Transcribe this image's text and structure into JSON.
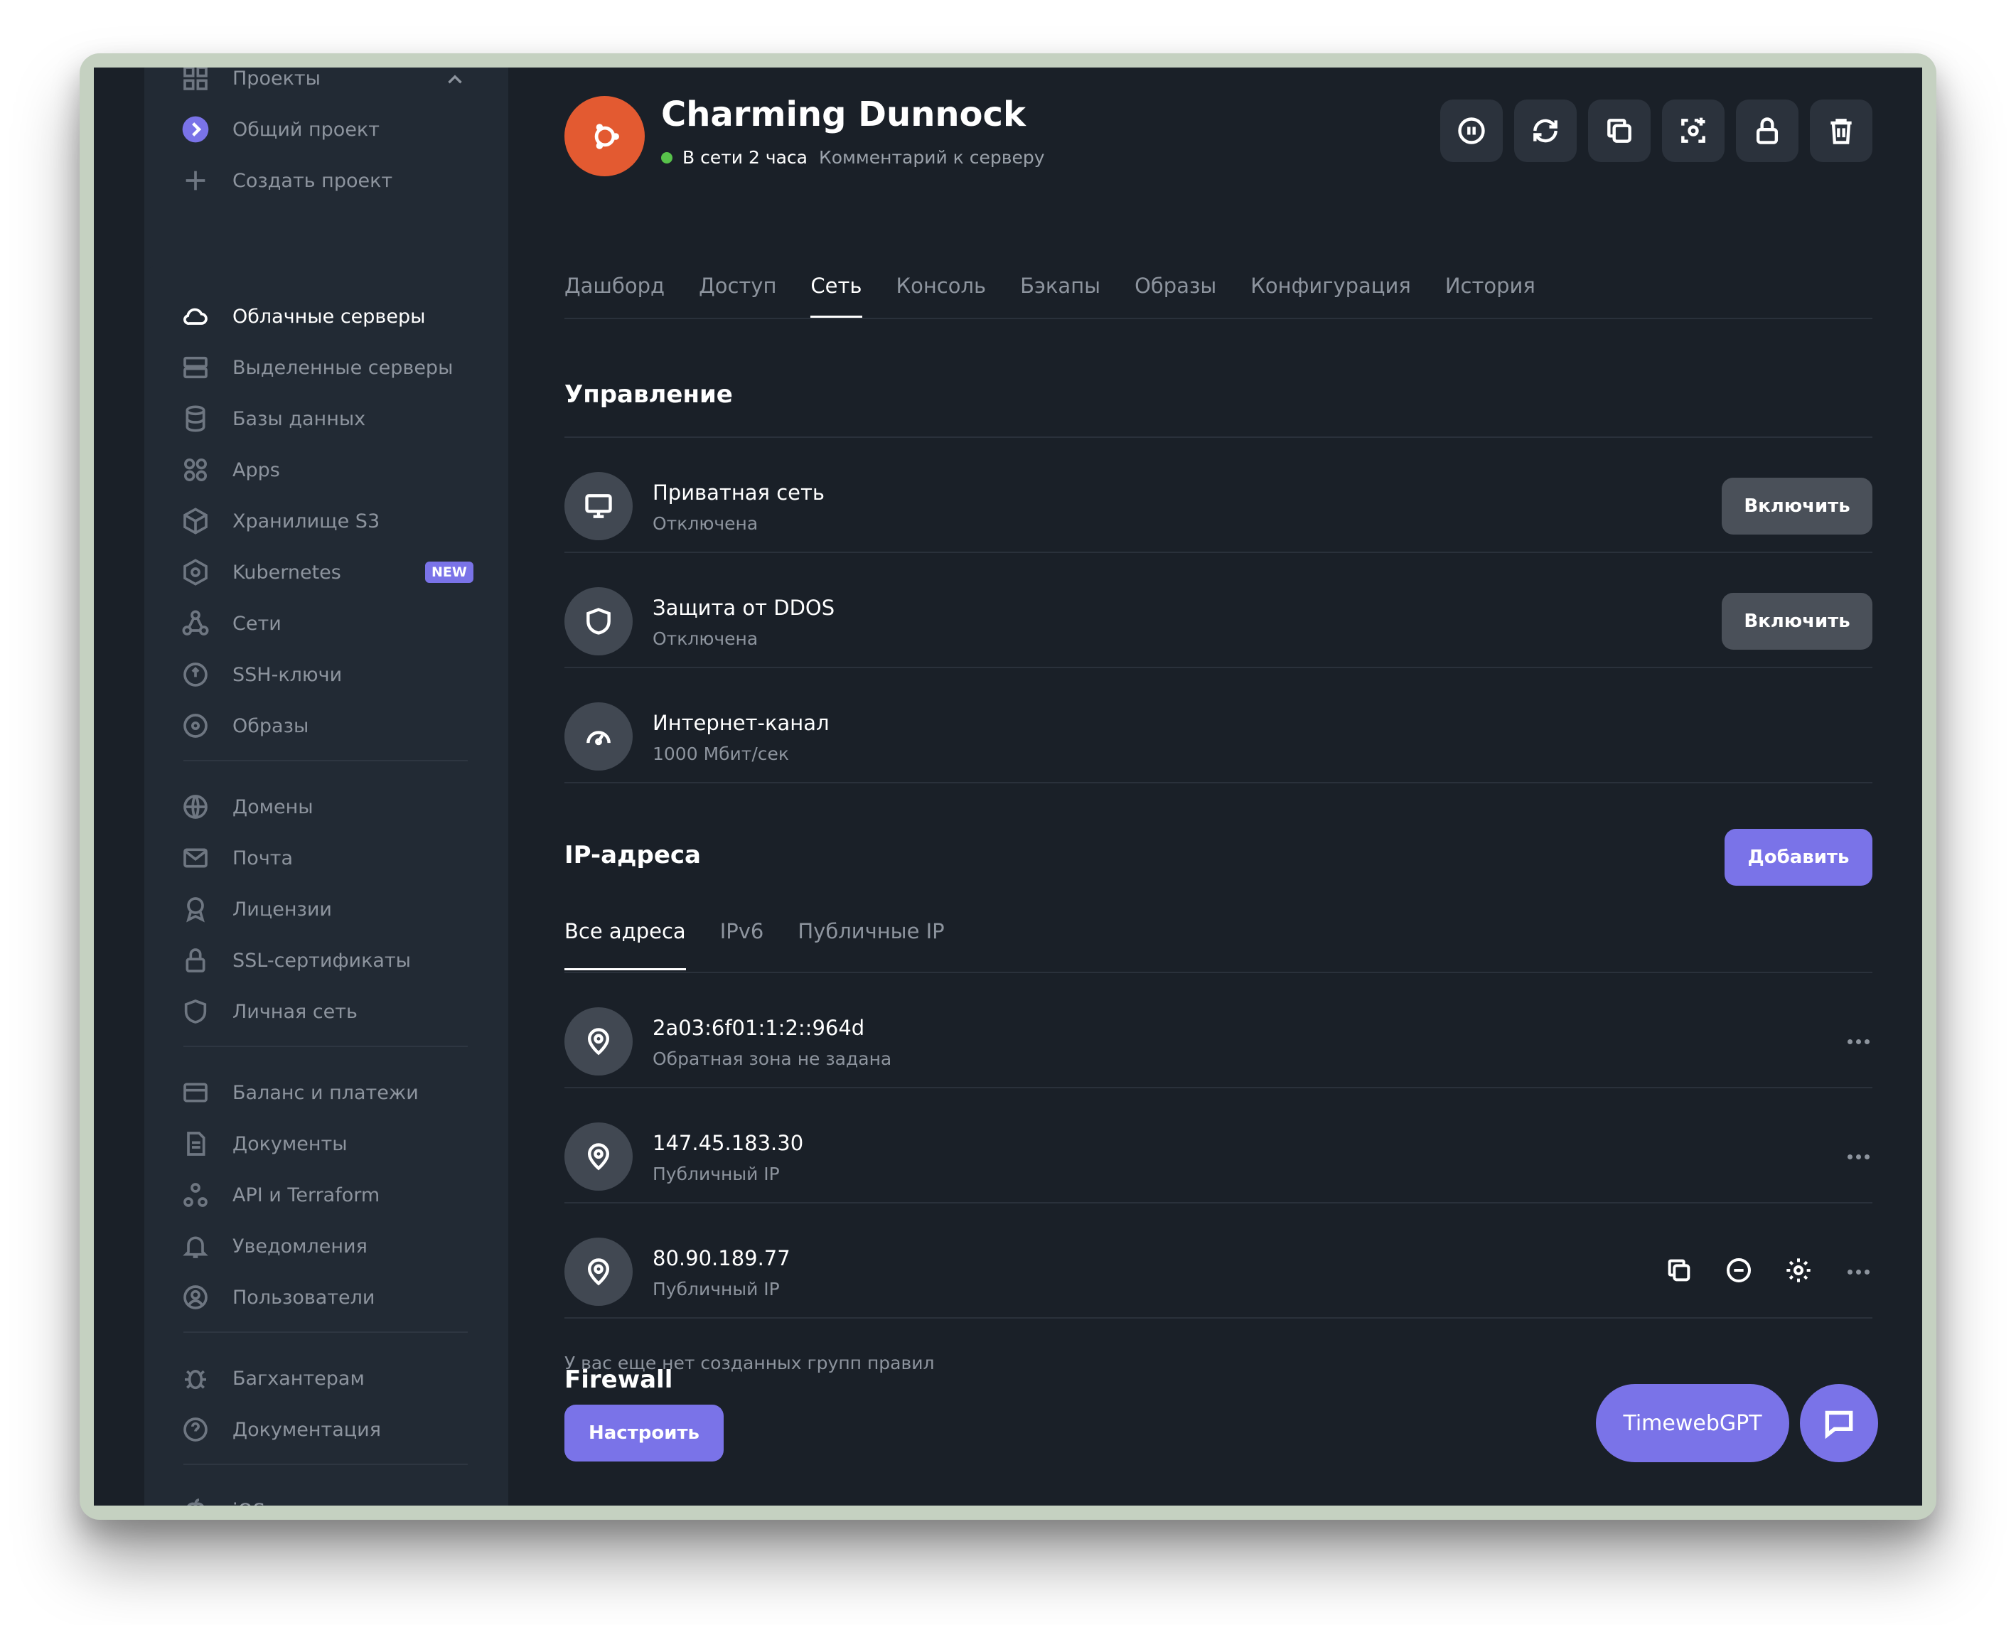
{
  "projects": {
    "header": "Проекты",
    "items": [
      "Общий проект",
      "Создать проект"
    ]
  },
  "sidebar": {
    "items": [
      {
        "label": "Облачные серверы",
        "icon": "cloud-icon"
      },
      {
        "label": "Выделенные серверы",
        "icon": "server-icon"
      },
      {
        "label": "Базы данных",
        "icon": "database-icon"
      },
      {
        "label": "Apps",
        "icon": "apps-icon"
      },
      {
        "label": "Хранилище S3",
        "icon": "cube-icon"
      },
      {
        "label": "Kubernetes",
        "icon": "kubernetes-icon",
        "badge": "NEW"
      },
      {
        "label": "Сети",
        "icon": "network-icon"
      },
      {
        "label": "SSH-ключи",
        "icon": "ssh-key-icon"
      },
      {
        "label": "Образы",
        "icon": "disc-icon"
      },
      {
        "label": "Домены",
        "icon": "globe-icon"
      },
      {
        "label": "Почта",
        "icon": "mail-icon"
      },
      {
        "label": "Лицензии",
        "icon": "license-icon"
      },
      {
        "label": "SSL-сертификаты",
        "icon": "lock-icon"
      },
      {
        "label": "Личная сеть",
        "icon": "shield-icon"
      },
      {
        "label": "Баланс и платежи",
        "icon": "card-icon"
      },
      {
        "label": "Документы",
        "icon": "document-icon"
      },
      {
        "label": "API и Terraform",
        "icon": "api-icon"
      },
      {
        "label": "Уведомления",
        "icon": "bell-icon"
      },
      {
        "label": "Пользователи",
        "icon": "user-icon"
      },
      {
        "label": "Багхантерам",
        "icon": "bug-icon"
      },
      {
        "label": "Документация",
        "icon": "help-icon"
      },
      {
        "label": "iOS приложение",
        "icon": "apple-icon"
      }
    ]
  },
  "server": {
    "name": "Charming Dunnock",
    "status": "В сети 2 часа",
    "comment": "Комментарий к серверу"
  },
  "tabs": [
    "Дашборд",
    "Доступ",
    "Сеть",
    "Консоль",
    "Бэкапы",
    "Образы",
    "Конфигурация",
    "История"
  ],
  "management": {
    "title": "Управление",
    "rows": [
      {
        "title": "Приватная сеть",
        "sub": "Отключена",
        "button": "Включить"
      },
      {
        "title": "Защита от DDOS",
        "sub": "Отключена",
        "button": "Включить"
      },
      {
        "title": "Интернет-канал",
        "sub": "1000 Мбит/сек"
      }
    ]
  },
  "ip": {
    "title": "IP-адреса",
    "add_label": "Добавить",
    "tabs": [
      "Все адреса",
      "IPv6",
      "Публичные IP"
    ],
    "rows": [
      {
        "address": "2a03:6f01:1:2::964d",
        "sub": "Обратная зона не задана"
      },
      {
        "address": "147.45.183.30",
        "sub": "Публичный IP"
      },
      {
        "address": "80.90.189.77",
        "sub": "Публичный IP"
      }
    ]
  },
  "firewall": {
    "title": "Firewall",
    "desc": "У вас еще нет созданных групп правил",
    "button": "Настроить"
  },
  "fab": {
    "gpt_label": "TimewebGPT"
  },
  "colors": {
    "accent": "#7a73e8",
    "background": "#1a2028",
    "avatar": "#e35a31",
    "online": "#58c24b"
  }
}
